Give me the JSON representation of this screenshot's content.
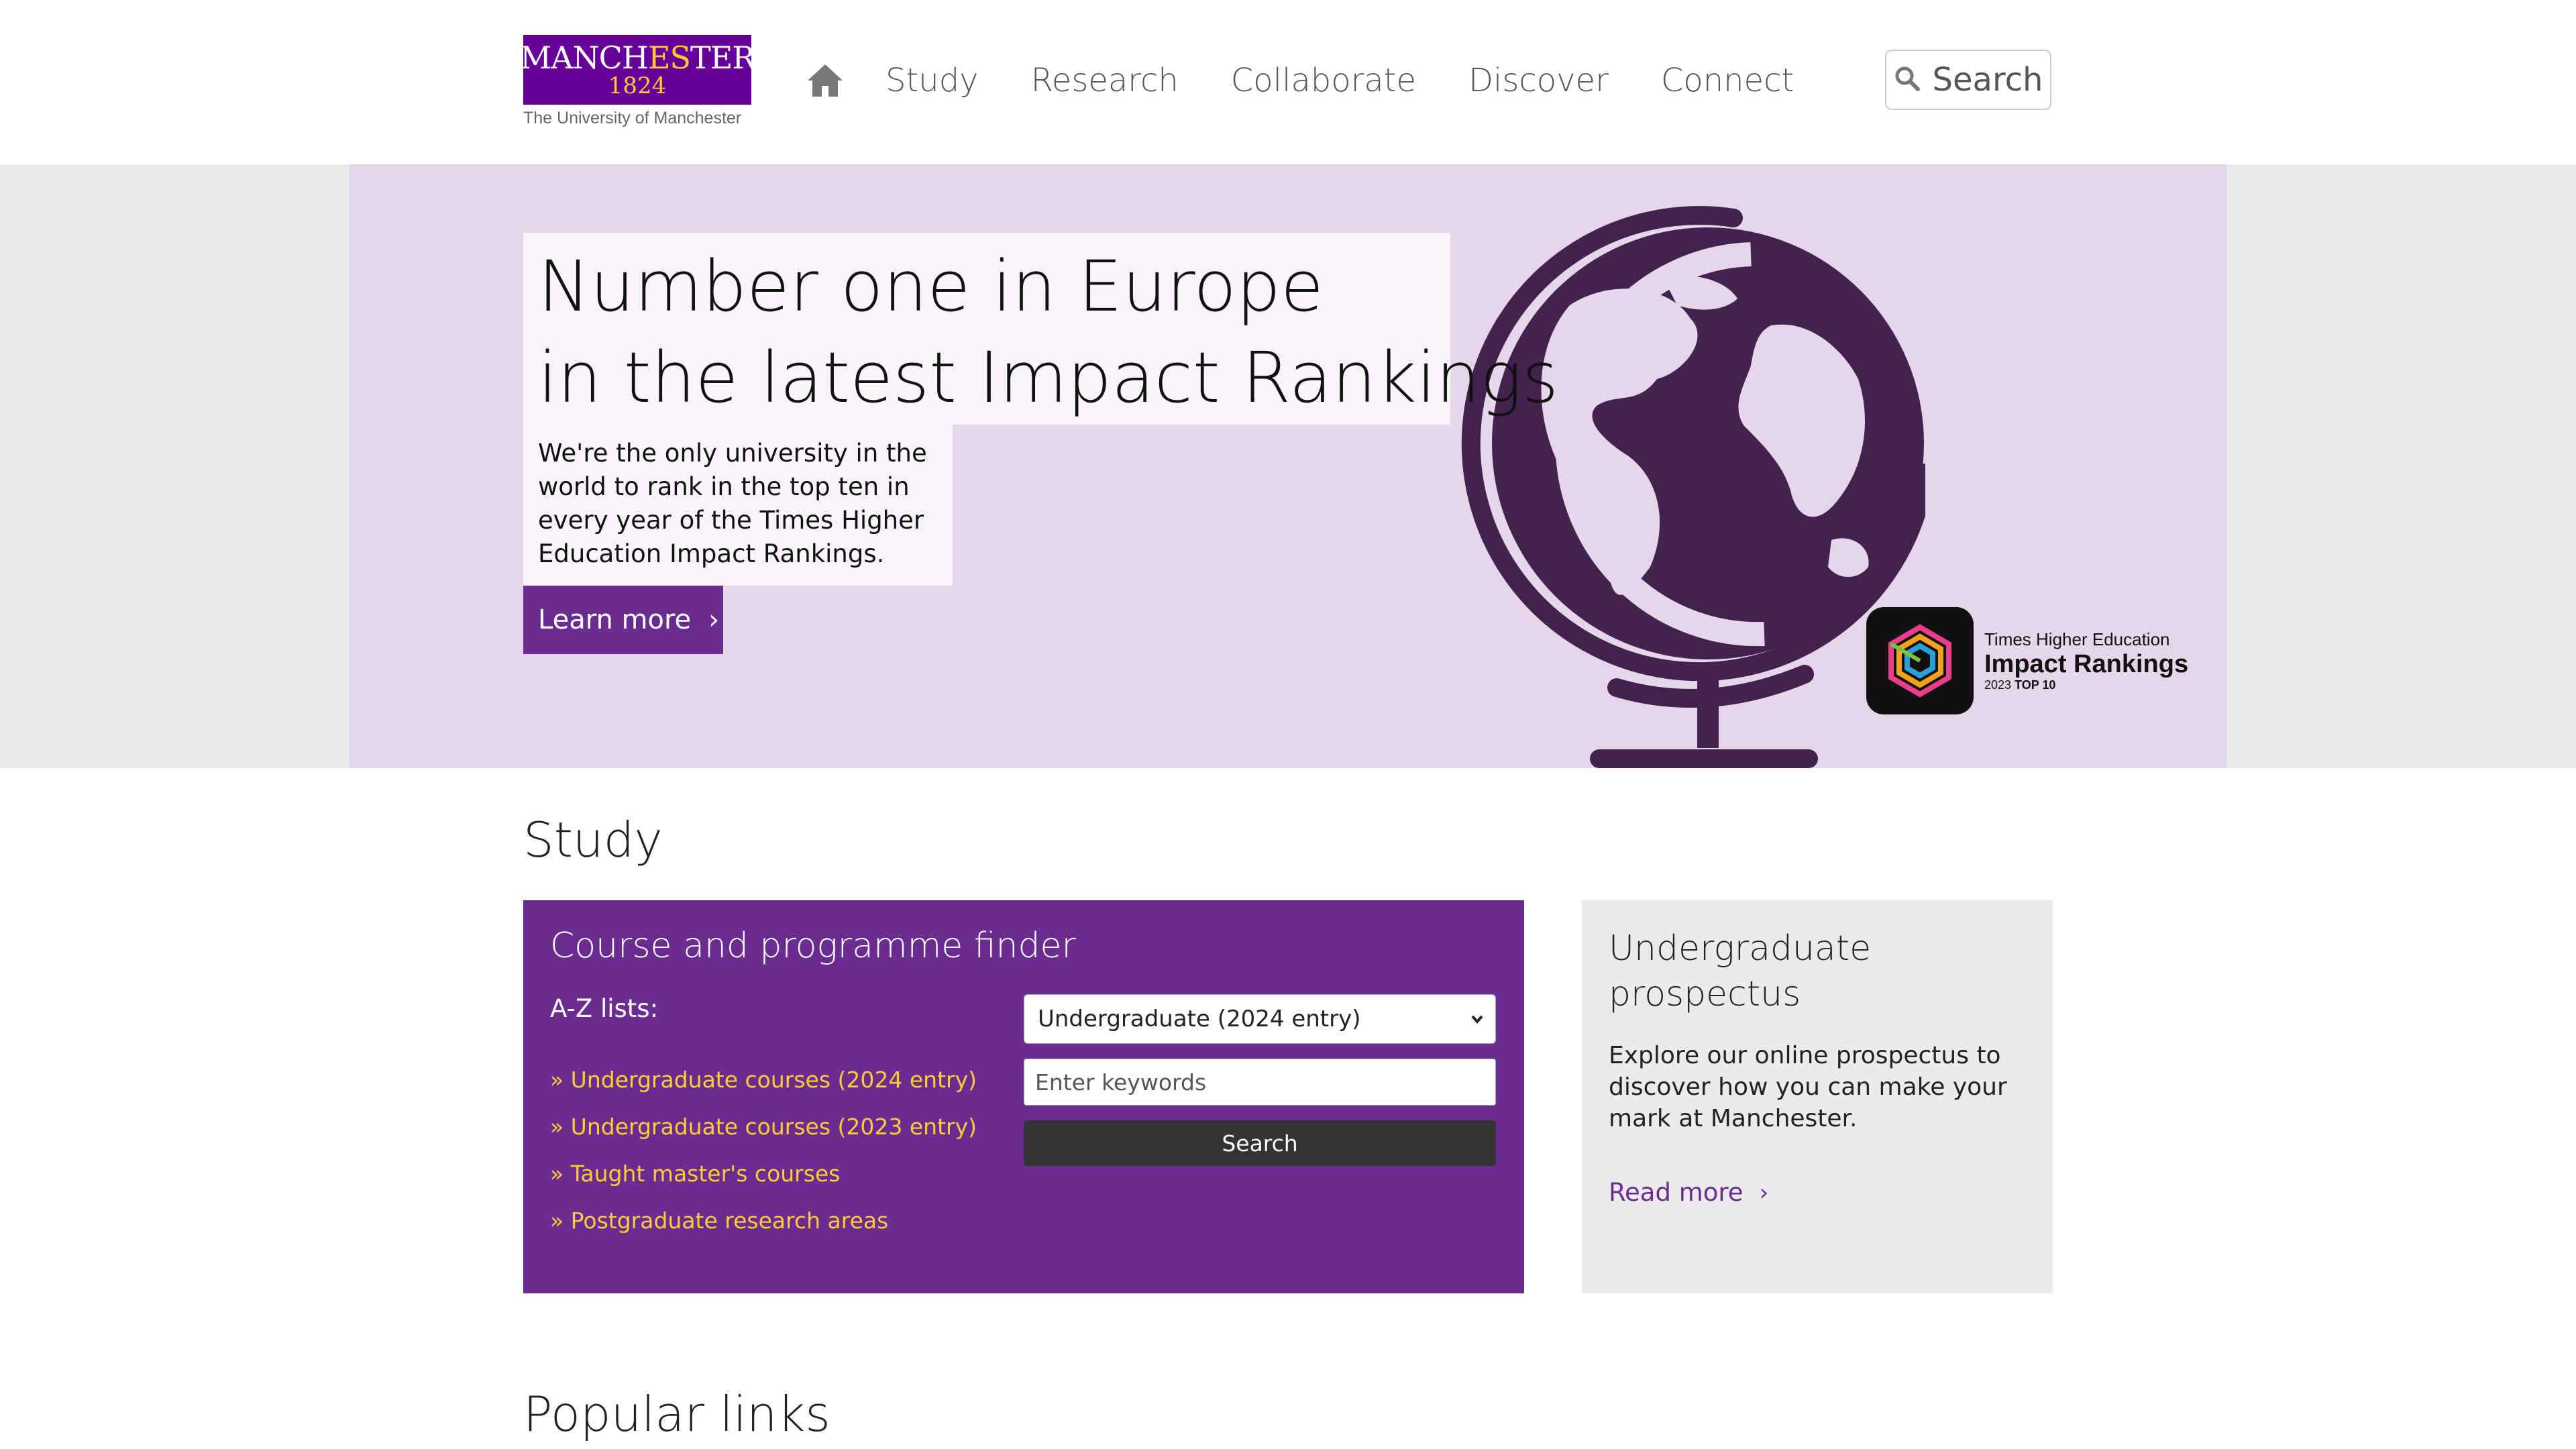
{
  "header": {
    "logo": {
      "wordmark": "MANCHESTER",
      "year": "1824",
      "subtitle": "The University of Manchester"
    },
    "nav": [
      {
        "label": "Study"
      },
      {
        "label": "Research"
      },
      {
        "label": "Collaborate"
      },
      {
        "label": "Discover"
      },
      {
        "label": "Connect"
      }
    ],
    "search_label": "Search"
  },
  "hero": {
    "title_line1": "Number one in Europe",
    "title_line2": "in the latest Impact Rankings",
    "description": "We're the only university in the world to rank in the top ten in every year of the Times Higher Education Impact Rankings.",
    "cta_label": "Learn more",
    "badge": {
      "line1": "Times Higher Education",
      "line2": "Impact Rankings",
      "year": "2023",
      "rank": "TOP 10"
    }
  },
  "study": {
    "heading": "Study",
    "finder": {
      "title": "Course and programme finder",
      "az_label": "A-Z lists:",
      "links": [
        "» Undergraduate courses (2024 entry)",
        "» Undergraduate courses (2023 entry)",
        "» Taught master's courses",
        "» Postgraduate research areas"
      ],
      "select_value": "Undergraduate (2024 entry)",
      "keywords_placeholder": "Enter keywords",
      "search_label": "Search"
    },
    "prospectus": {
      "title": "Undergraduate prospectus",
      "text": "Explore our online prospectus to discover how you can make your mark at Manchester.",
      "link_label": "Read more"
    }
  },
  "popular": {
    "heading": "Popular links"
  },
  "colors": {
    "brand_purple": "#660099",
    "accent_purple": "#6b2c91",
    "gold": "#ffcc33",
    "hero_bg": "#e5d6ea"
  }
}
